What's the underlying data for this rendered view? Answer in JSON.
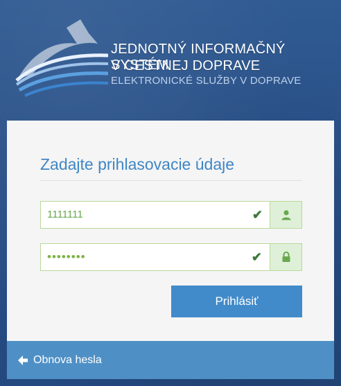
{
  "brand": {
    "line1": "JEDNOTNÝ INFORMAČNÝ SYSTÉM",
    "line2": "V CESTNEJ DOPRAVE",
    "line3": "ELEKTRONICKÉ SLUŽBY V DOPRAVE"
  },
  "form": {
    "title": "Zadajte prihlasovacie údaje",
    "username_value": "1111111",
    "password_value": "••••••••",
    "submit_label": "Prihlásiť"
  },
  "footer": {
    "recovery_link": "Obnova hesla"
  },
  "colors": {
    "accent": "#428bca",
    "title": "#3f86c5",
    "valid": "#6aa84f",
    "background": "#2a5188"
  },
  "icons": {
    "logo": "mountain-logo-icon",
    "user": "user-icon",
    "lock": "lock-icon",
    "check": "checkmark-icon",
    "back": "arrow-left-icon"
  }
}
